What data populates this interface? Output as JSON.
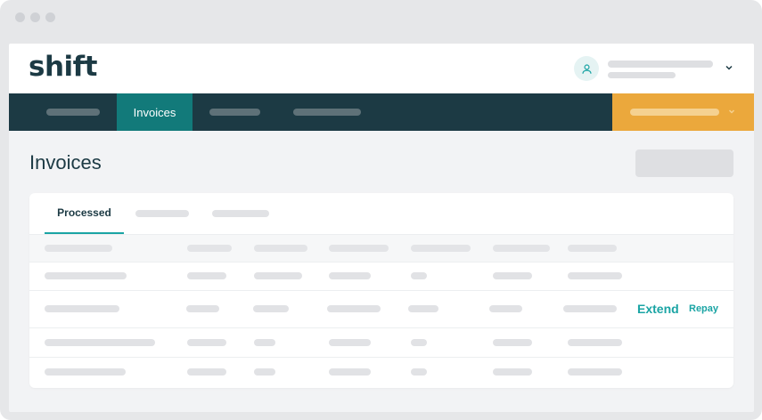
{
  "brand": {
    "logo_text": "shift"
  },
  "nav": {
    "active_tab": "Invoices"
  },
  "page": {
    "title": "Invoices"
  },
  "tabs": {
    "active": "Processed"
  },
  "table": {
    "actions_row_index": 2,
    "actions": {
      "extend": "Extend",
      "repay": "Repay"
    }
  },
  "colors": {
    "brand_dark": "#1c3a44",
    "brand_teal": "#127a7a",
    "accent_teal": "#1aa4a4",
    "cta_orange": "#eba83c"
  }
}
